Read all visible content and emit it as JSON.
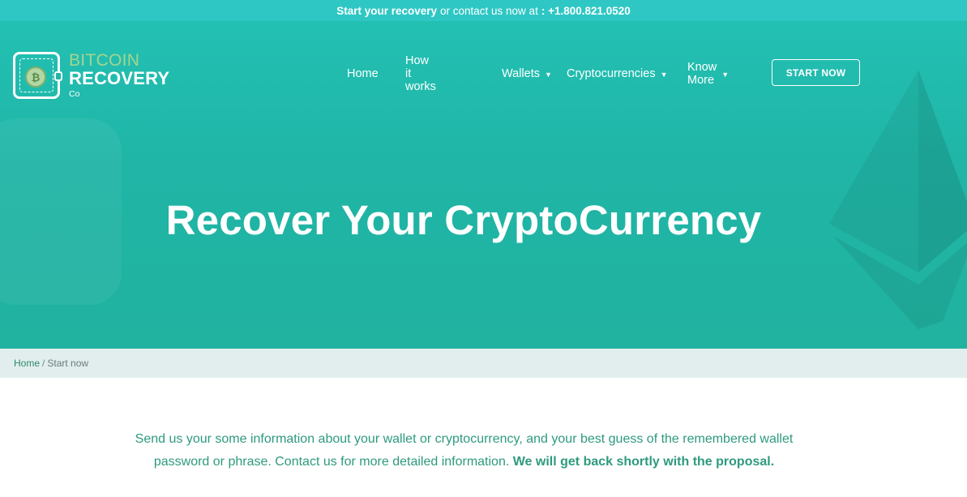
{
  "topbar": {
    "cta": "Start your recovery",
    "middle": "or contact us now at",
    "phone": ": +1.800.821.0520"
  },
  "logo": {
    "line1": "BITCOIN",
    "line2": "RECOVERY",
    "line3": "Co",
    "coin_symbol": "₿"
  },
  "nav": {
    "items": [
      {
        "label": "Home"
      },
      {
        "label": "How it works"
      },
      {
        "label": "Wallets"
      },
      {
        "label": "Cryptocurrencies"
      },
      {
        "label": "Know More"
      }
    ],
    "cta_label": "START NOW"
  },
  "hero": {
    "title": "Recover Your CryptoCurrency"
  },
  "breadcrumb": {
    "home": "Home",
    "separator": "/",
    "current": "Start now"
  },
  "intro": {
    "text": "Send us your some information about your wallet or cryptocurrency, and your best guess of the remembered wallet password or phrase. Contact us for more detailed information.",
    "emphasis": "We will get back shortly with the proposal."
  },
  "colors": {
    "topbar": "#2ec7c4",
    "hero": "#20b5a6",
    "breadcrumb_bg": "#e1eeed",
    "text_accent": "#2e9a7e",
    "logo_green": "#a5d48e"
  }
}
